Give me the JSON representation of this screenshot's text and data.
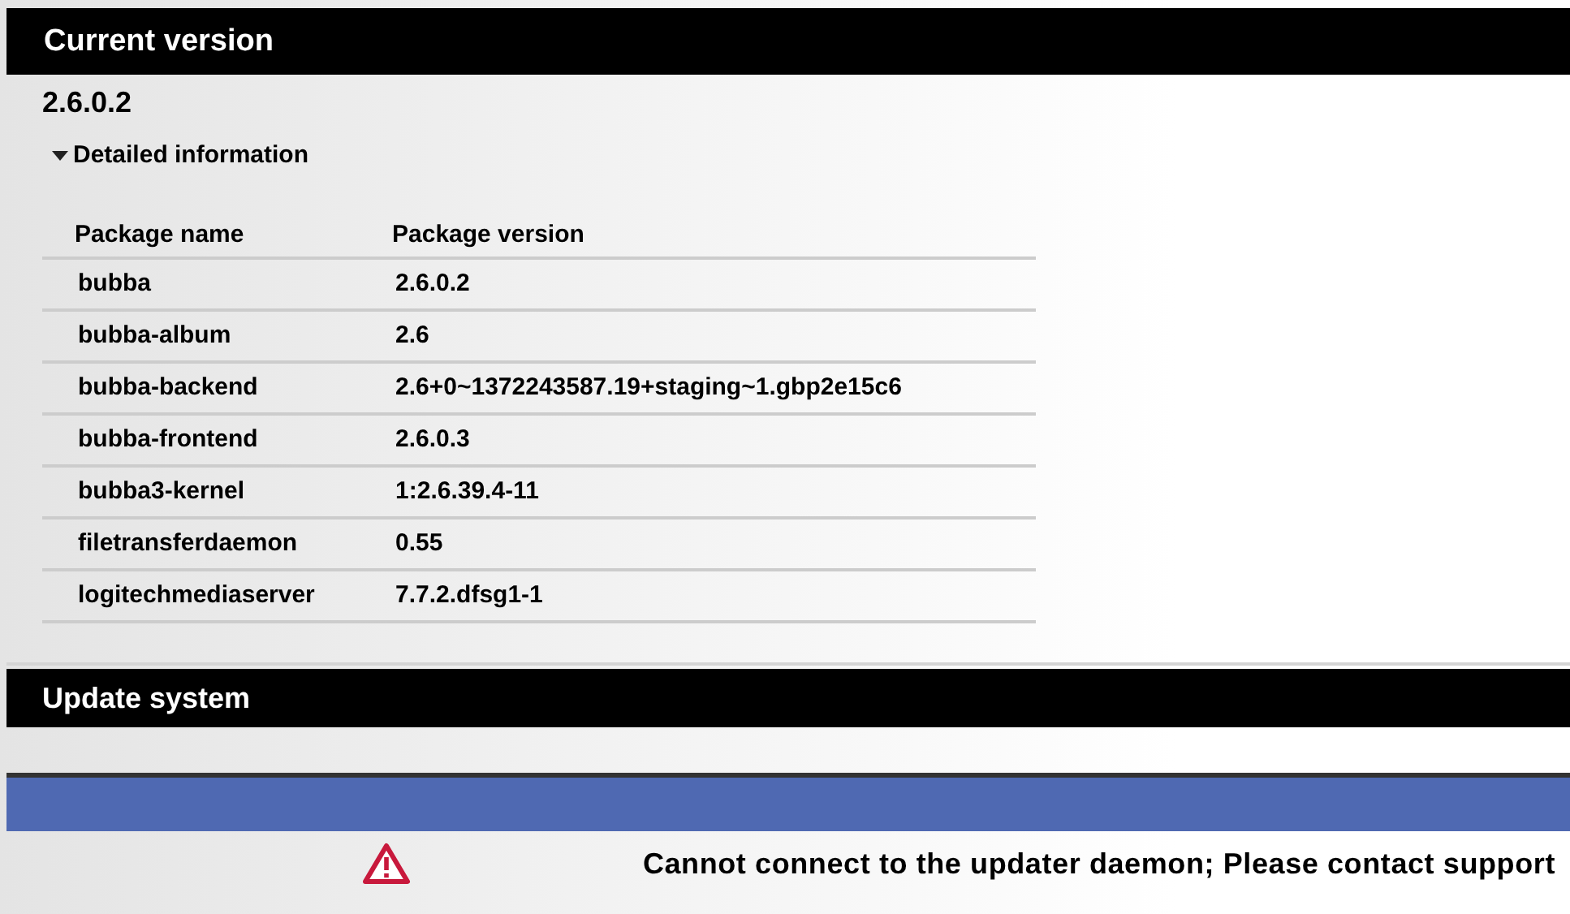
{
  "current_version": {
    "title": "Current version",
    "version": "2.6.0.2",
    "details": {
      "label": "Detailed information",
      "expanded": true
    },
    "table": {
      "columns": [
        "Package name",
        "Package version"
      ],
      "rows": [
        {
          "name": "bubba",
          "version": "2.6.0.2"
        },
        {
          "name": "bubba-album",
          "version": "2.6"
        },
        {
          "name": "bubba-backend",
          "version": "2.6+0~1372243587.19+staging~1.gbp2e15c6"
        },
        {
          "name": "bubba-frontend",
          "version": "2.6.0.3"
        },
        {
          "name": "bubba3-kernel",
          "version": "1:2.6.39.4-11"
        },
        {
          "name": "filetransferdaemon",
          "version": "0.55"
        },
        {
          "name": "logitechmediaserver",
          "version": "7.7.2.dfsg1-1"
        }
      ]
    }
  },
  "update_system": {
    "title": "Update system",
    "message": "Cannot connect to the updater daemon; Please contact support"
  }
}
